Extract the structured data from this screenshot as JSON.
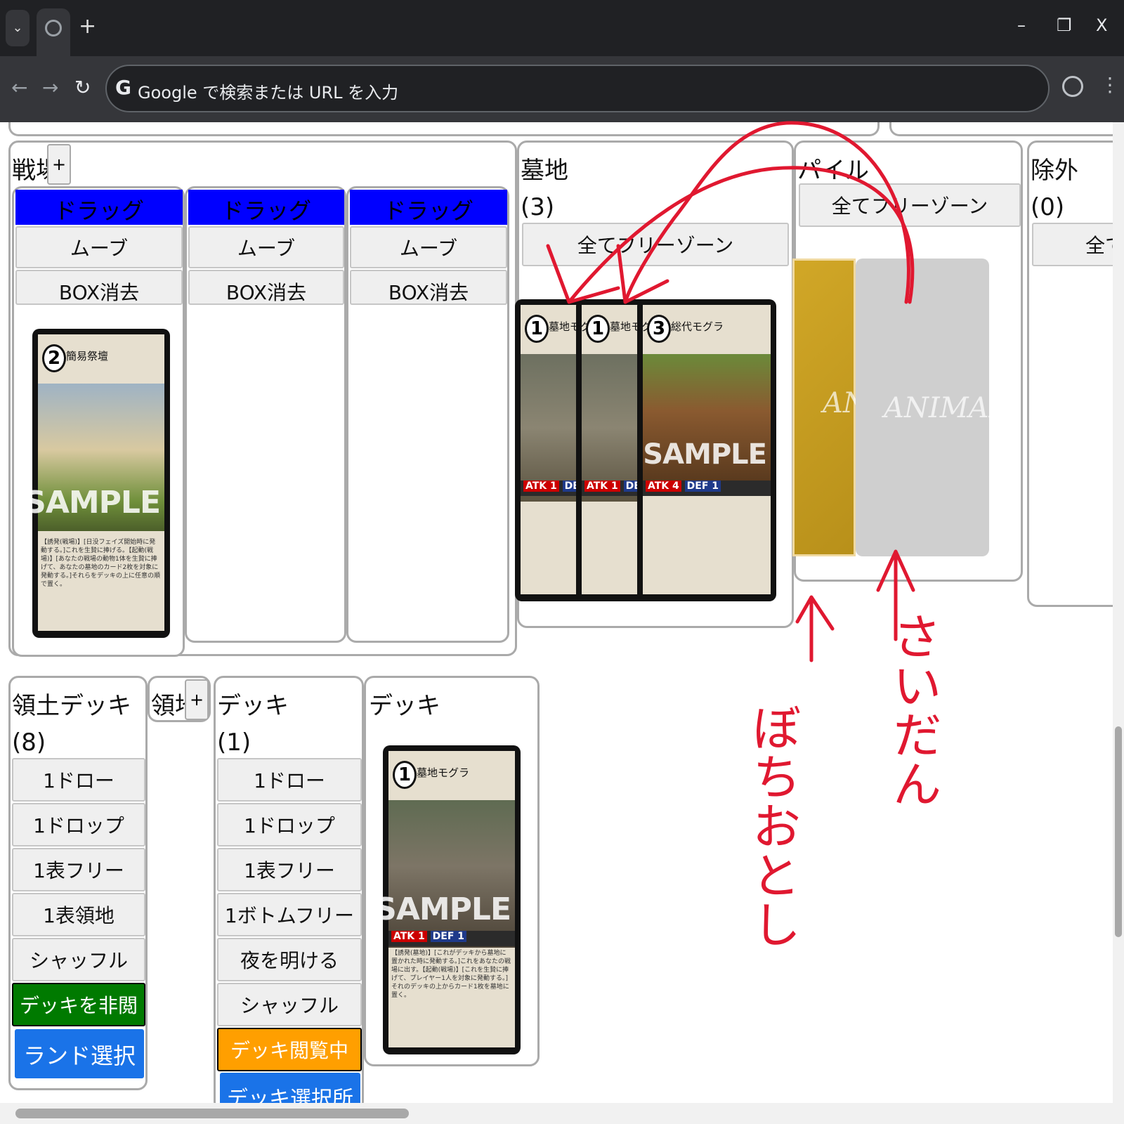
{
  "browser": {
    "tab_menu_icon": "chevron-down-icon",
    "tab_icon": "globe-icon",
    "new_tab": "+",
    "minimize": "–",
    "restore": "❐",
    "close": "X",
    "back": "←",
    "forward": "→",
    "reload": "↻",
    "omnibox_logo": "G",
    "omnibox_placeholder": "Google で検索または URL を入力",
    "menu": "⋮"
  },
  "battlefield": {
    "title": "戦場",
    "add": "+",
    "columns": [
      {
        "drag": "ドラッグ",
        "move": "ムーブ",
        "delete": "BOX消去"
      },
      {
        "drag": "ドラッグ",
        "move": "ムーブ",
        "delete": "BOX消去"
      },
      {
        "drag": "ドラッグ",
        "move": "ムーブ",
        "delete": "BOX消去"
      }
    ],
    "card": {
      "cost": "2",
      "name": "簡易祭壇",
      "sample": "SAMPLE",
      "text": "【誘発(戦場)】[日没フェイズ開始時に発動する。]これを生贄に捧げる。【起動(戦場)】[あなたの戦場の動物1体を生贄に捧げて、あなたの墓地のカード2枚を対象に発動する。]それらをデッキの上に任意の順で置く。"
    }
  },
  "graveyard": {
    "title": "墓地",
    "count": "(3)",
    "all_free": "全てフリーゾーン",
    "cards": [
      {
        "cost": "1",
        "name": "墓地モグラ",
        "atk": "ATK 1",
        "def": "DEF"
      },
      {
        "cost": "1",
        "name": "墓地モグラ",
        "atk": "ATK 1",
        "def": "DEF"
      },
      {
        "cost": "3",
        "name": "総代モグラ",
        "atk": "ATK 4",
        "def": "DEF 1",
        "sample": "SAMPLE"
      }
    ]
  },
  "pile": {
    "title": "パイル",
    "all_free": "全てフリーゾーン",
    "sleeve_logo": "ANIMAL"
  },
  "exile": {
    "title": "除外",
    "count": "(0)",
    "all_free": "全て"
  },
  "territory_deck": {
    "title": "領土デッキ",
    "count": "(8)",
    "buttons": [
      "1ドロー",
      "1ドロップ",
      "1表フリー",
      "1表領地",
      "シャッフル"
    ],
    "viewing": "デッキを非閲覧中",
    "select": "ランド選択"
  },
  "territory": {
    "title": "領地",
    "add": "+"
  },
  "deck": {
    "title": "デッキ",
    "count": "(1)",
    "buttons": [
      "1ドロー",
      "1ドロップ",
      "1表フリー",
      "1ボトムフリー",
      "夜を明ける",
      "シャッフル"
    ],
    "viewing": "デッキ閲覧中",
    "select": "デッキ選択所"
  },
  "deck_view": {
    "title": "デッキ",
    "card": {
      "cost": "1",
      "name": "墓地モグラ",
      "atk": "ATK 1",
      "def": "DEF 1",
      "sample": "SAMPLE",
      "text": "【誘発(墓地)】[これがデッキから墓地に置かれた時に発動する。]これをあなたの戦場に出す。【起動(戦場)】[これを生贄に捧げて、プレイヤー1人を対象に発動する。]それのデッキの上からカード1枚を墓地に置く。"
    }
  },
  "annotations": {
    "left_label": "ぼちおとし",
    "right_label": "さいだん",
    "color": "#e01830"
  }
}
